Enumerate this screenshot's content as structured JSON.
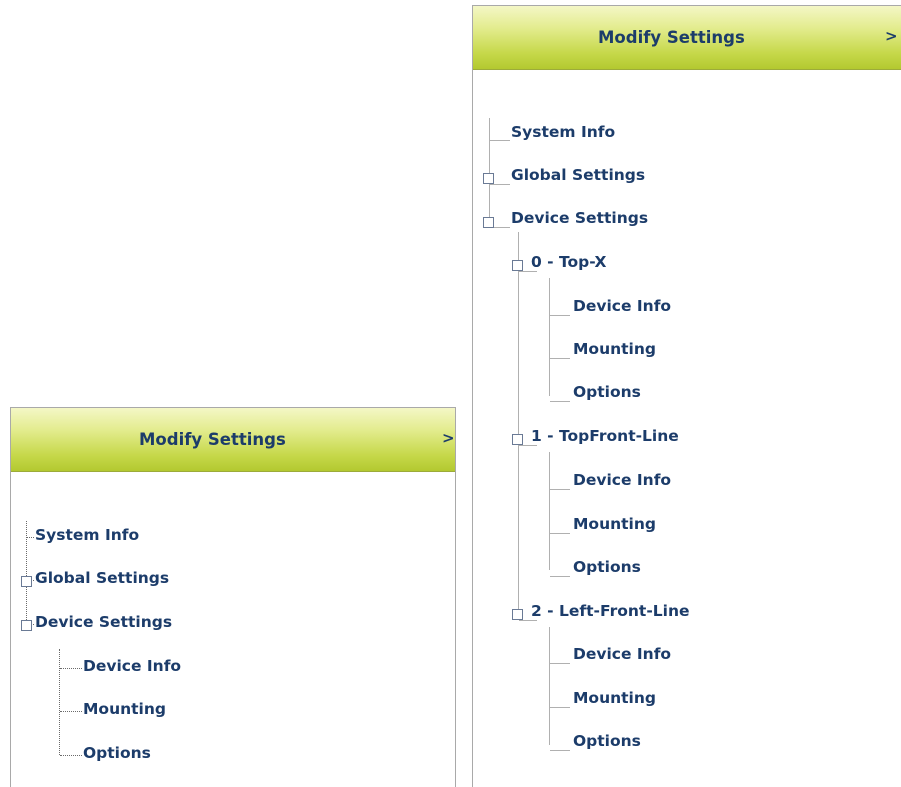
{
  "small_panel": {
    "title": "Modify Settings",
    "chevron": ">",
    "tree": {
      "system_info": "System Info",
      "global_settings": "Global Settings",
      "device_settings": "Device Settings",
      "children": [
        "Device Info",
        "Mounting",
        "Options"
      ]
    }
  },
  "big_panel": {
    "title": "Modify Settings",
    "chevron": ">",
    "tree": {
      "system_info": "System Info",
      "global_settings": "Global Settings",
      "device_settings": "Device Settings",
      "devices": [
        {
          "label": "0 - Top-X",
          "children": [
            "Device Info",
            "Mounting",
            "Options"
          ]
        },
        {
          "label": "1 - TopFront-Line",
          "children": [
            "Device Info",
            "Mounting",
            "Options"
          ]
        },
        {
          "label": "2 - Left-Front-Line",
          "children": [
            "Device Info",
            "Mounting",
            "Options"
          ]
        }
      ]
    }
  }
}
